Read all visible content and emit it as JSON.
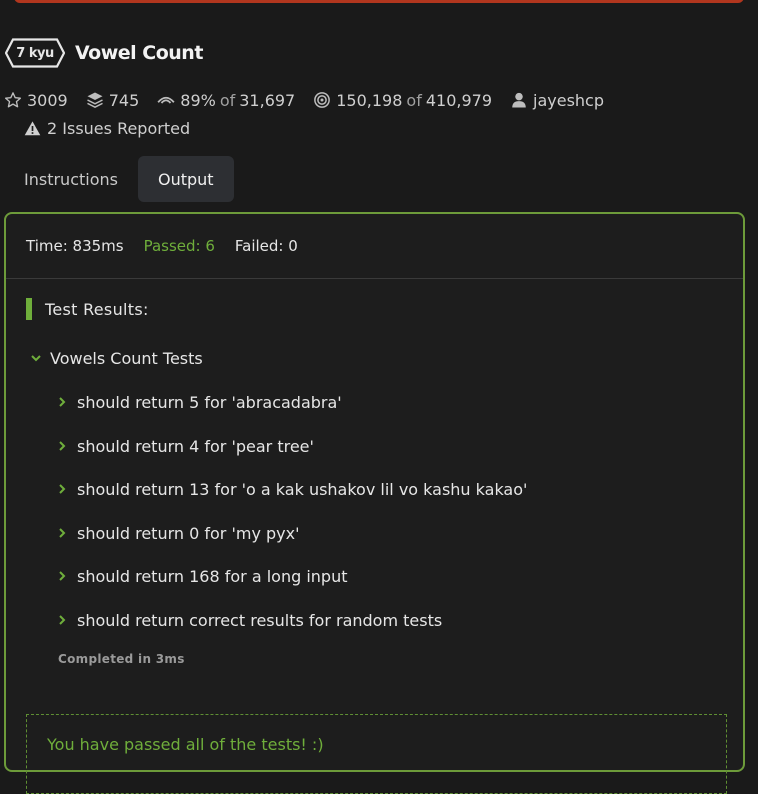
{
  "kata": {
    "rank": "7 kyu",
    "title": "Vowel Count",
    "stars": "3009",
    "collections": "745",
    "satisfaction": "89%",
    "satisfaction_of": "of",
    "satisfaction_total": "31,697",
    "completed": "150,198",
    "completed_of": "of",
    "completed_total": "410,979",
    "author": "jayeshcp",
    "issues": "2 Issues Reported"
  },
  "tabs": [
    {
      "label": "Instructions",
      "active": false
    },
    {
      "label": "Output",
      "active": true
    }
  ],
  "output": {
    "time": "Time: 835ms",
    "passed": "Passed: 6",
    "failed": "Failed: 0",
    "results_title": "Test Results:",
    "describe_title": "Vowels Count Tests",
    "tests": [
      "should return 5 for 'abracadabra'",
      "should return 4 for 'pear tree'",
      "should return 13 for 'o a kak ushakov lil vo kashu kakao'",
      "should return 0 for 'my pyx'",
      "should return 168 for a long input",
      "should return correct results for random tests"
    ],
    "completed_in": "Completed in 3ms",
    "success_message": "You have passed all of the tests! :)"
  },
  "colors": {
    "accent_green": "#6fae3b",
    "border_green": "#6d9b3a",
    "top_bar_red": "#b1361e"
  },
  "icons": {
    "star": "star-icon",
    "collections": "stack-icon",
    "satisfaction": "eye-icon",
    "completed": "target-icon",
    "author": "user-icon",
    "issues": "warning-icon",
    "chevron_down": "chevron-down-icon",
    "chevron_right": "chevron-right-icon"
  }
}
